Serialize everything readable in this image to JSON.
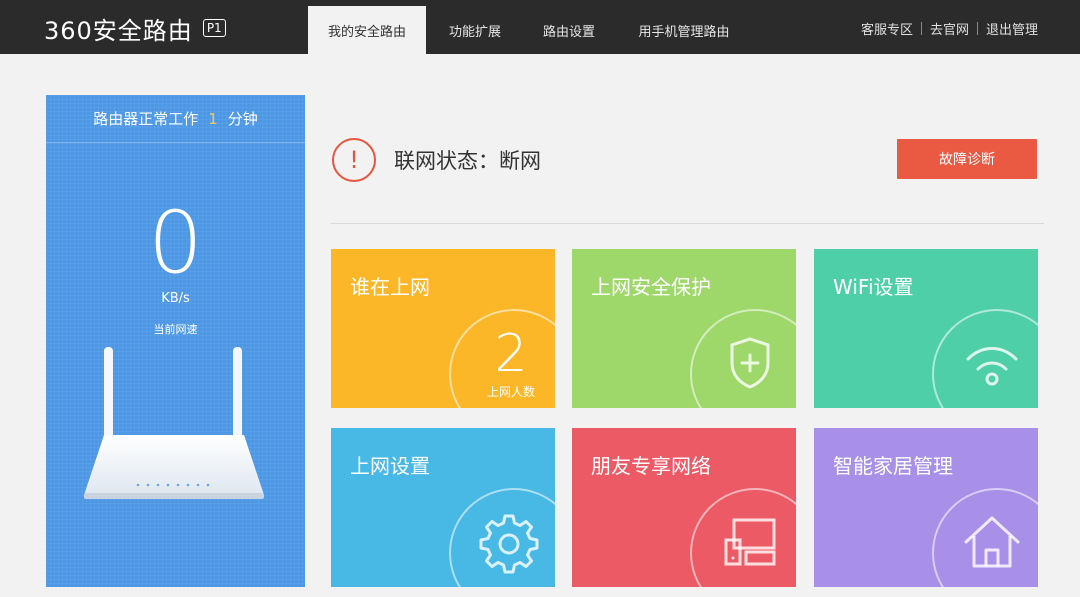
{
  "header": {
    "logo_text": "360安全路由",
    "logo_badge": "P1",
    "nav": [
      {
        "label": "我的安全路由",
        "active": true
      },
      {
        "label": "功能扩展",
        "active": false
      },
      {
        "label": "路由设置",
        "active": false
      },
      {
        "label": "用手机管理路由",
        "active": false
      }
    ],
    "links": [
      "客服专区",
      "去官网",
      "退出管理"
    ]
  },
  "left_panel": {
    "uptime_prefix": "路由器正常工作",
    "uptime_value": "1",
    "uptime_suffix": "分钟",
    "speed_value": "0",
    "speed_unit": "KB/s",
    "speed_label": "当前网速"
  },
  "status": {
    "icon": "exclamation-icon",
    "text": "联网状态：断网",
    "diagnose_label": "故障诊断"
  },
  "tiles": [
    {
      "title": "谁在上网",
      "count": "2",
      "count_label": "上网人数",
      "color": "#fbb728"
    },
    {
      "title": "上网安全保护",
      "icon": "shield-plus-icon",
      "color": "#9ed86a"
    },
    {
      "title": "WiFi设置",
      "icon": "wifi-icon",
      "color": "#4fcfa8"
    },
    {
      "title": "上网设置",
      "icon": "gear-icon",
      "color": "#47b9e4"
    },
    {
      "title": "朋友专享网络",
      "icon": "devices-icon",
      "color": "#ec5a66"
    },
    {
      "title": "智能家居管理",
      "icon": "home-icon",
      "color": "#a890e8"
    }
  ],
  "colors": {
    "topbar": "#2b2b2b",
    "left_panel": "#4d98e6",
    "accent_red": "#ea5a42",
    "uptime_number": "#f9c74f"
  }
}
